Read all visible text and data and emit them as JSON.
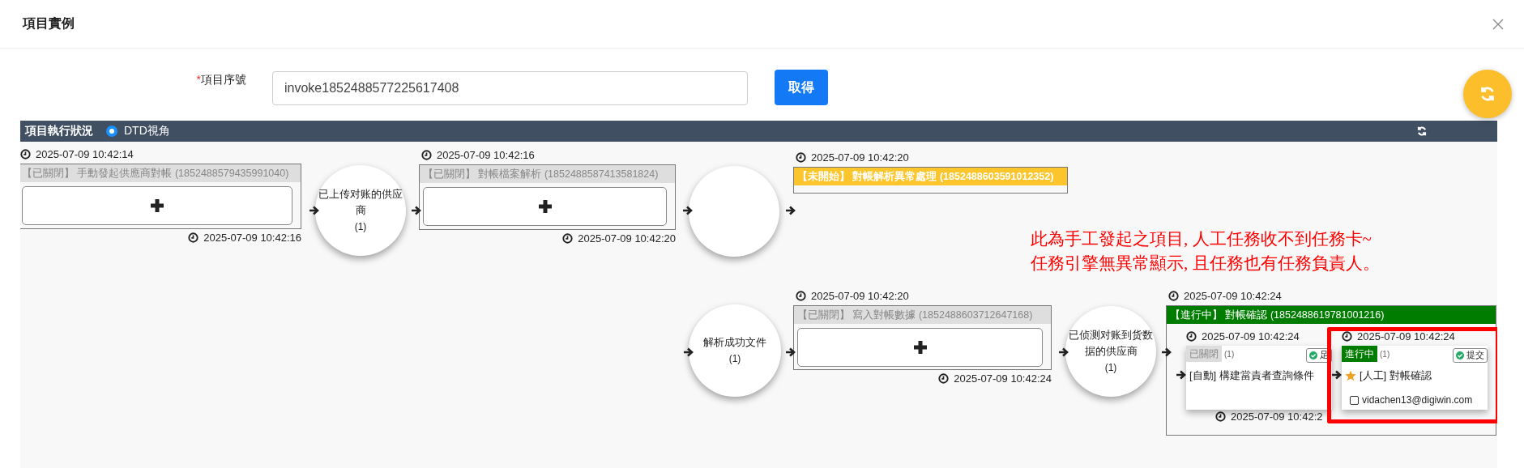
{
  "dialog": {
    "title": "項目實例"
  },
  "query": {
    "required_mark": "*",
    "label": "項目序號",
    "value": "invoke1852488577225617408",
    "button": "取得"
  },
  "panel": {
    "title": "項目執行狀況",
    "view_option": {
      "label": "DTD視角",
      "selected": true
    }
  },
  "flow": [
    {
      "kind": "task",
      "header": {
        "kind": "closed",
        "text": "【已關閉】 手動發起供應商對帳 (1852488579435991040)"
      },
      "start_time": "2025-07-09 10:42:14",
      "end_time": "2025-07-09 10:42:16",
      "expandable": true
    },
    {
      "kind": "state",
      "label": "已上传对账的供应商",
      "count": "(1)"
    },
    {
      "kind": "task",
      "header": {
        "kind": "closed",
        "text": "【已關閉】 對帳檔案解析 (1852488587413581824)"
      },
      "start_time": "2025-07-09 10:42:16",
      "end_time": "2025-07-09 10:42:20",
      "expandable": true
    },
    {
      "kind": "state"
    },
    {
      "kind": "task",
      "header": {
        "kind": "waiting",
        "text": "【未開始】 對帳解析異常處理 (1852488603591012352)"
      },
      "start_time": "2025-07-09 10:42:20",
      "expandable": false
    },
    {
      "kind": "state",
      "label": "解析成功文件",
      "count": "(1)"
    },
    {
      "kind": "task",
      "header": {
        "kind": "closed",
        "text": "【已關閉】 寫入對帳數據 (1852488603712647168)"
      },
      "start_time": "2025-07-09 10:42:20",
      "end_time": "2025-07-09 10:42:24",
      "expandable": true
    },
    {
      "kind": "state",
      "label": "已侦测对账到货数据的供应商",
      "count": "(1)"
    },
    {
      "kind": "task",
      "header": {
        "kind": "running",
        "text": "【進行中】 對帳確認 (1852488619781001216)"
      },
      "start_time": "2025-07-09 10:42:24",
      "expandable": false,
      "subtasks": [
        {
          "tag": {
            "kind": "closed",
            "text": "已關閉"
          },
          "count": "(1)",
          "action": "足",
          "starred": false,
          "name": "[自動] 構建當責者查詢條件",
          "start_time": "2025-07-09 10:42:24",
          "end_time": "2025-07-09 10:42:2",
          "highlighted": false
        },
        {
          "tag": {
            "kind": "running",
            "text": "進行中"
          },
          "count": "(1)",
          "action": "提交",
          "starred": true,
          "name": "[人工] 對帳確認",
          "assignee": "vidachen13@digiwin.com",
          "start_time": "2025-07-09 10:42:24",
          "highlighted": true
        }
      ]
    }
  ],
  "annotation": {
    "lines": [
      "此為手工發起之項目, 人工任務收不到任務卡~",
      "任務引擎無異常顯示, 且任務也有任務負責人。"
    ]
  }
}
